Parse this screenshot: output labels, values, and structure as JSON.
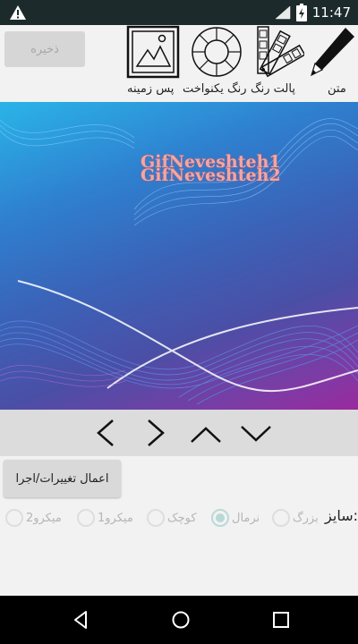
{
  "status_bar": {
    "time": "11:47",
    "icons": [
      "warning-icon",
      "wifi-icon",
      "battery-charging-icon"
    ],
    "background": "#1c2a2b"
  },
  "toolbar": {
    "save_label": "ذخیره",
    "tools": [
      {
        "name": "text",
        "label": "متن",
        "icon": "pencil-icon"
      },
      {
        "name": "palette",
        "label": "پالت رنگ",
        "icon": "color-swatches-icon"
      },
      {
        "name": "solid_color",
        "label": "رنگ یکنواخت",
        "icon": "color-wheel-icon"
      },
      {
        "name": "background",
        "label": "پس زمینه",
        "icon": "image-icon"
      }
    ]
  },
  "preview": {
    "text_lines": [
      "GifNeveshteh1",
      "GifNeveshteh2"
    ],
    "text_color": "#f4a6a0"
  },
  "arrows": {
    "items": [
      "left-arrow-icon",
      "right-arrow-icon",
      "up-arrow-icon",
      "down-arrow-icon"
    ]
  },
  "apply_button": {
    "label": "اعمال تغییرات/اجرا"
  },
  "size": {
    "label": "سایز:",
    "options": [
      {
        "label": "بزرگ",
        "selected": false
      },
      {
        "label": "نرمال",
        "selected": true
      },
      {
        "label": "کوچک",
        "selected": false
      },
      {
        "label": "میکرو1",
        "selected": false
      },
      {
        "label": "میکرو2",
        "selected": false
      }
    ]
  },
  "nav_bar": {
    "buttons": [
      "back-icon",
      "home-icon",
      "recents-icon"
    ]
  }
}
